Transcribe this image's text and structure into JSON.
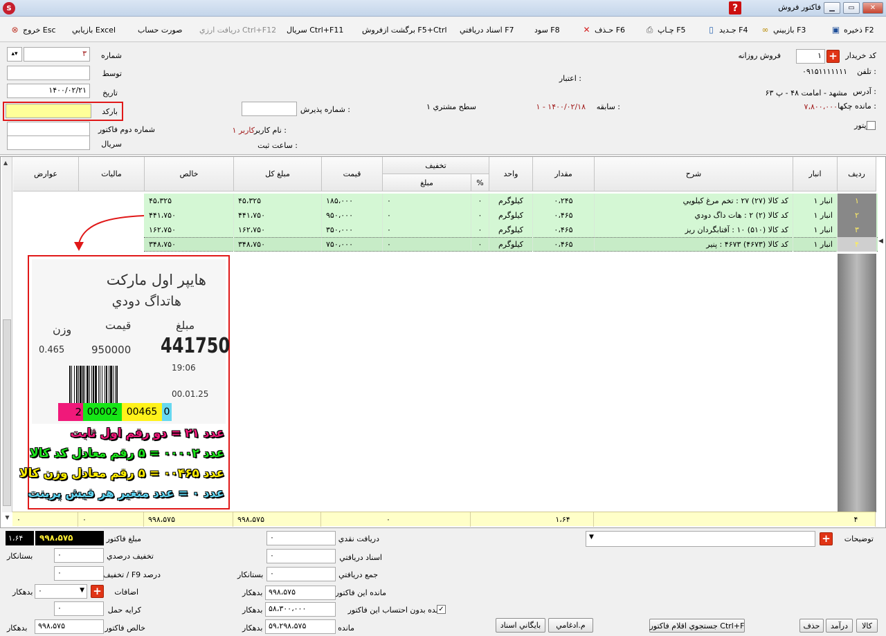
{
  "window": {
    "title": "فاکتور فروش",
    "app_icon": "S",
    "help": "?"
  },
  "toolbar": {
    "save": "ذخيره F2",
    "revisit": "بازبيني F3",
    "new": "جـديد F4",
    "print": "چـاپ F5",
    "delete": "حـذف F6",
    "profit": "سود F8",
    "received_docs": "اسناد دريافتي F7",
    "return_sale": "برگشت ازفروش F5+Ctrl",
    "serial": "سريال  Ctrl+F11",
    "fx_receive": "دريافت ارزي  Ctrl+F12",
    "account_statement": "صورت حساب",
    "excel_review": "بازيابي Excel",
    "exit": "خروج Esc"
  },
  "form": {
    "buyer_code_label": "کد خريدار",
    "buyer_code": "۱",
    "daily_sale_label": "فروش روزانه",
    "phone_label": "تلفن :",
    "phone": "۰۹۱۵۱۱۱۱۱۱۱",
    "credit_label": "اعتبار :",
    "address_label": "آدرس :",
    "address": "مشهد - امامت ۴۸ - پ ۶۳",
    "cheque_balance_label": "مانده چکها :",
    "cheque_balance": "۷،۸۰۰،۰۰۰",
    "history_label": "سابقه :",
    "history": "۱ - ۱۴۰۰/۰۲/۱۸",
    "customer_level": "سطح مشتري ۱",
    "reception_no_label": "شماره پذيرش :",
    "username_label": "نام کاربر :",
    "username": "کاربر ۱",
    "reg_time_label": "ساعت ثبت :",
    "visitor_label": "ويزيتور",
    "number_label": "شماره",
    "number": "۳",
    "by_label": "توسط",
    "date_label": "تاريخ",
    "date": "۱۴۰۰/۰۲/۲۱",
    "barcode_label": "بارکد",
    "second_invoice_label": "شماره دوم فاکتور",
    "serial_label": "سريال"
  },
  "grid": {
    "headers": {
      "row": "رديف",
      "store": "انبار",
      "desc": "شرح",
      "qty": "مقدار",
      "unit": "واحد",
      "discount": "تخفيف",
      "disc_pct": "%",
      "disc_amt": "مبلغ",
      "price": "قيمت",
      "total": "مبلغ کل",
      "net": "خالص",
      "tax": "ماليات",
      "levy": "عوارض"
    },
    "rows": [
      {
        "num": "۱",
        "store": "انبار ۱",
        "desc": "کد کالا (۲۷) ۲۷ : تخم مرغ کيلويي",
        "qty": "۰،۲۴۵",
        "unit": "کيلوگرم",
        "pct": "۰",
        "amt": "۰",
        "price": "۱۸۵،۰۰۰",
        "total": "۴۵،۳۲۵",
        "net": "۴۵،۳۲۵"
      },
      {
        "num": "۲",
        "store": "انبار ۱",
        "desc": "کد کالا (۲) ۲ : هات داگ دودي",
        "qty": "۰،۴۶۵",
        "unit": "کيلوگرم",
        "pct": "۰",
        "amt": "۰",
        "price": "۹۵۰،۰۰۰",
        "total": "۴۴۱،۷۵۰",
        "net": "۴۴۱،۷۵۰"
      },
      {
        "num": "۳",
        "store": "انبار ۱",
        "desc": "کد کالا (۵۱۰) ۱۰ : آفتابگردان ريز",
        "qty": "۰،۴۶۵",
        "unit": "کيلوگرم",
        "pct": "۰",
        "amt": "۰",
        "price": "۳۵۰،۰۰۰",
        "total": "۱۶۲،۷۵۰",
        "net": "۱۶۲،۷۵۰"
      },
      {
        "num": "۴",
        "store": "انبار ۱",
        "desc": "کد کالا (۴۶۷۳) ۴۶۷۳ : پنير",
        "qty": "۰،۴۶۵",
        "unit": "کيلوگرم",
        "pct": "۰",
        "amt": "۰",
        "price": "۷۵۰،۰۰۰",
        "total": "۳۴۸،۷۵۰",
        "net": "۳۴۸،۷۵۰"
      }
    ],
    "summary": {
      "count": "۴",
      "qty": "۱،۶۴",
      "amt": "۰",
      "total": "۹۹۸،۵۷۵",
      "net": "۹۹۸،۵۷۵",
      "tax": "۰",
      "levy": "۰"
    }
  },
  "receipt": {
    "store": "هايپر اول مارکت",
    "product": "هاتداگ دودي",
    "col_amount": "مبلغ",
    "col_price": "قيمت",
    "col_weight": "وزن",
    "weight": "0.465",
    "price": "950000",
    "amount": "441750",
    "time": "19:06",
    "date": "00.01.25",
    "bc1": "2",
    "bc2": "00002",
    "bc3": "00465",
    "bc4": "0"
  },
  "annotations": {
    "line1": "عدد ۲۱ = دو رقم اول ثابت",
    "line2": "عدد ۰۰۰۰۲ = ۵ رقم معادل کد کالا",
    "line3": "عدد ۰۰۴۶۵ = ۵ رقم معادل وزن کالا",
    "line4": "عدد ۰ = عدد متغير هر فيش پرينت"
  },
  "bottom": {
    "invoice_amount_label": "مبلغ فاکتور",
    "invoice_amount": "۹۹۸،۵۷۵",
    "invoice_qty": "۱،۶۴",
    "pct_discount_label": "تخفيف درصدي",
    "creditor1": "بستانکار",
    "f9_discount_label": "تخفيف / F9 درصد",
    "additions_label": "اضافات",
    "debtor1": "بدهکار",
    "freight_label": "کرايه حمل",
    "net_invoice_label": "خالص فاکتور",
    "net_invoice": "۹۹۸،۵۷۵",
    "debtor2": "بدهکار",
    "cash_label": "دريافت نقدي",
    "cash": "۰",
    "docs_label": "اسناد دريافتي",
    "docs": "۰",
    "total_received_label": "جمع دريافتي",
    "total_received": "۰",
    "creditor2": "بستانکار",
    "invoice_balance_label": "مانده اين فاکتور",
    "invoice_balance": "۹۹۸،۵۷۵",
    "debtor3": "بدهکار",
    "balance_without_label": "مانده بدون احتساب اين فاکتور",
    "balance_without": "۵۸،۳۰۰،۰۰۰",
    "debtor4": "بدهکار",
    "balance_label": "مانده",
    "balance": "۵۹،۲۹۸،۵۷۵",
    "debtor5": "بدهکار",
    "notes_label": "توضيحات",
    "btn_goods": "کالا",
    "btn_income": "درآمد",
    "btn_delete": "حذف",
    "btn_search": "جستجوي اقلام فاکتور Ctrl+F",
    "btn_merged": "م.ادغامي",
    "btn_archive": "بايگاني اسناد"
  },
  "colors": {
    "row_bg": "#d4f7d4",
    "barcode_field": "#ffff99",
    "red_border": "#e01818",
    "total_bg": "#ffffc8",
    "dark_total": "#000000"
  }
}
